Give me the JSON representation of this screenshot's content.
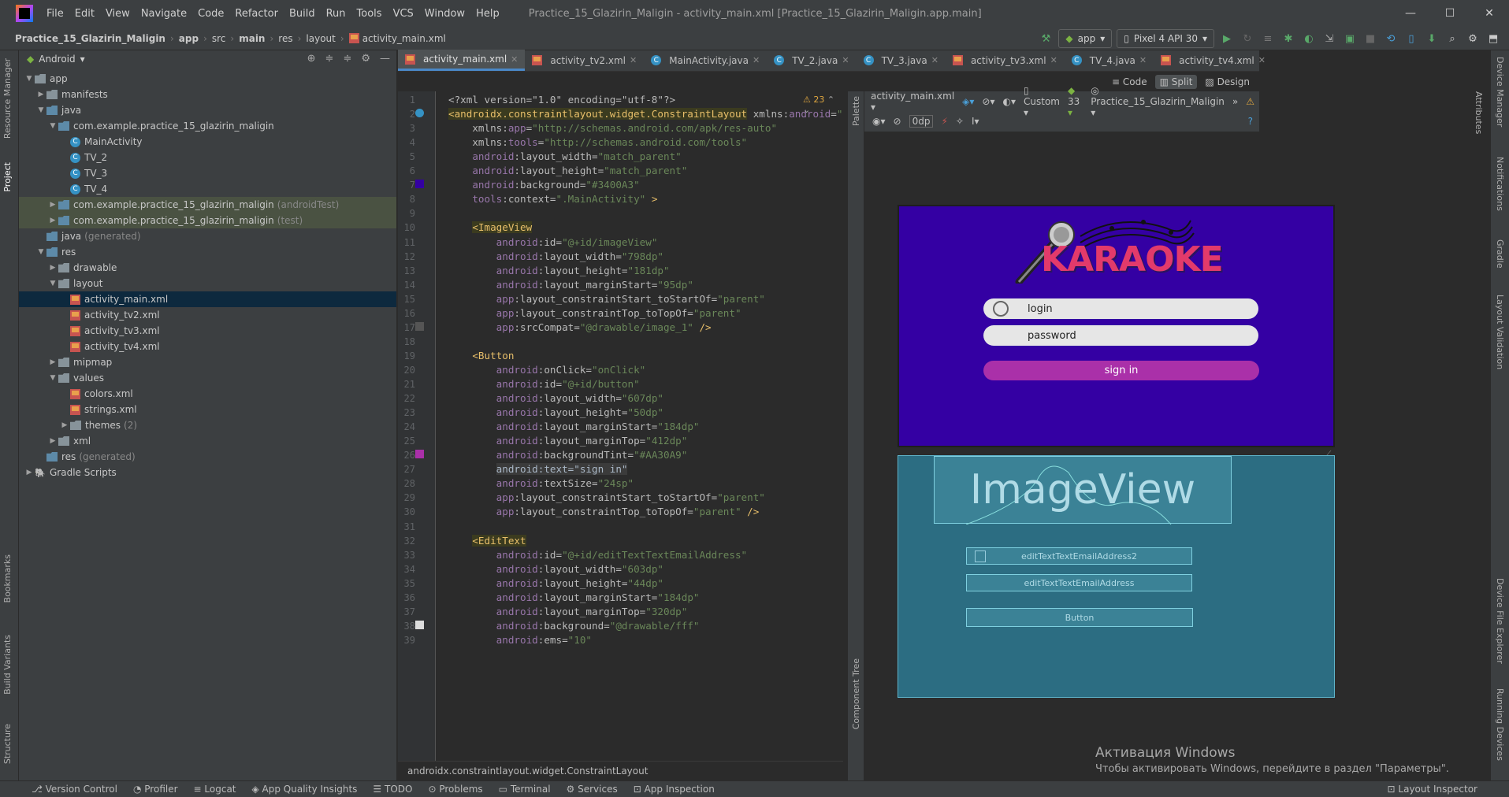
{
  "window": {
    "menu": [
      "File",
      "Edit",
      "View",
      "Navigate",
      "Code",
      "Refactor",
      "Build",
      "Run",
      "Tools",
      "VCS",
      "Window",
      "Help"
    ],
    "title": "Practice_15_Glazirin_Maligin - activity_main.xml [Practice_15_Glazirin_Maligin.app.main]",
    "controls": [
      "—",
      "☐",
      "✕"
    ]
  },
  "breadcrumb": [
    "Practice_15_Glazirin_Maligin",
    "app",
    "src",
    "main",
    "res",
    "layout",
    "activity_main.xml"
  ],
  "run": {
    "config": "app",
    "device": "Pixel 4 API 30"
  },
  "left_strip": [
    "Resource Manager",
    "Project",
    "Bookmarks",
    "Build Variants",
    "Structure"
  ],
  "right_strip": [
    "Device Manager",
    "Notifications",
    "Gradle",
    "Layout Validation",
    "Device File Explorer",
    "Running Devices"
  ],
  "right_strip_top": "Attributes",
  "project": {
    "view": "Android",
    "tree": [
      {
        "label": "app",
        "indent": 0,
        "arrow": "▼",
        "icon": "folder"
      },
      {
        "label": "manifests",
        "indent": 1,
        "arrow": "▶",
        "icon": "folder"
      },
      {
        "label": "java",
        "indent": 1,
        "arrow": "▼",
        "icon": "folder"
      },
      {
        "label": "com.example.practice_15_glazirin_maligin",
        "indent": 2,
        "arrow": "▼",
        "icon": "folder"
      },
      {
        "label": "MainActivity",
        "indent": 3,
        "arrow": "",
        "icon": "class"
      },
      {
        "label": "TV_2",
        "indent": 3,
        "arrow": "",
        "icon": "class"
      },
      {
        "label": "TV_3",
        "indent": 3,
        "arrow": "",
        "icon": "class"
      },
      {
        "label": "TV_4",
        "indent": 3,
        "arrow": "",
        "icon": "class"
      },
      {
        "label": "com.example.practice_15_glazirin_maligin",
        "suffix": "(androidTest)",
        "indent": 2,
        "arrow": "▶",
        "icon": "folder",
        "hl": true
      },
      {
        "label": "com.example.practice_15_glazirin_maligin",
        "suffix": "(test)",
        "indent": 2,
        "arrow": "▶",
        "icon": "folder",
        "hl": true
      },
      {
        "label": "java",
        "suffix": "(generated)",
        "indent": 1,
        "arrow": "",
        "icon": "folder"
      },
      {
        "label": "res",
        "indent": 1,
        "arrow": "▼",
        "icon": "folder"
      },
      {
        "label": "drawable",
        "indent": 2,
        "arrow": "▶",
        "icon": "folder"
      },
      {
        "label": "layout",
        "indent": 2,
        "arrow": "▼",
        "icon": "folder"
      },
      {
        "label": "activity_main.xml",
        "indent": 3,
        "arrow": "",
        "icon": "xml",
        "sel": true
      },
      {
        "label": "activity_tv2.xml",
        "indent": 3,
        "arrow": "",
        "icon": "xml"
      },
      {
        "label": "activity_tv3.xml",
        "indent": 3,
        "arrow": "",
        "icon": "xml"
      },
      {
        "label": "activity_tv4.xml",
        "indent": 3,
        "arrow": "",
        "icon": "xml"
      },
      {
        "label": "mipmap",
        "indent": 2,
        "arrow": "▶",
        "icon": "folder"
      },
      {
        "label": "values",
        "indent": 2,
        "arrow": "▼",
        "icon": "folder"
      },
      {
        "label": "colors.xml",
        "indent": 3,
        "arrow": "",
        "icon": "xml"
      },
      {
        "label": "strings.xml",
        "indent": 3,
        "arrow": "",
        "icon": "xml"
      },
      {
        "label": "themes",
        "suffix": "(2)",
        "indent": 3,
        "arrow": "▶",
        "icon": "folder"
      },
      {
        "label": "xml",
        "indent": 2,
        "arrow": "▶",
        "icon": "folder"
      },
      {
        "label": "res",
        "suffix": "(generated)",
        "indent": 1,
        "arrow": "",
        "icon": "folder"
      },
      {
        "label": "Gradle Scripts",
        "indent": 0,
        "arrow": "▶",
        "icon": "gradle"
      }
    ]
  },
  "tabs": [
    "activity_main.xml",
    "activity_tv2.xml",
    "MainActivity.java",
    "TV_2.java",
    "TV_3.java",
    "activity_tv3.xml",
    "TV_4.java",
    "activity_tv4.xml"
  ],
  "view_modes": [
    "Code",
    "Split",
    "Design"
  ],
  "warnings": "23",
  "code_lines": [
    [
      {
        "t": "<?xml version=\"1.0\" encoding=\"utf-8\"?>",
        "c": "attr"
      }
    ],
    [
      {
        "t": "<androidx.constraintlayout.widget.ConstraintLayout",
        "c": "tagbg"
      },
      {
        "t": " xmlns:",
        "c": "attr"
      },
      {
        "t": "android",
        "c": "ns"
      },
      {
        "t": "=",
        "c": "attr"
      },
      {
        "t": "\"http://schem",
        "c": "val"
      }
    ],
    [
      {
        "t": "    xmlns:",
        "c": "attr"
      },
      {
        "t": "app",
        "c": "ns"
      },
      {
        "t": "=",
        "c": "attr"
      },
      {
        "t": "\"http://schemas.android.com/apk/res-auto\"",
        "c": "val"
      }
    ],
    [
      {
        "t": "    xmlns:",
        "c": "attr"
      },
      {
        "t": "tools",
        "c": "ns"
      },
      {
        "t": "=",
        "c": "attr"
      },
      {
        "t": "\"http://schemas.android.com/tools\"",
        "c": "val"
      }
    ],
    [
      {
        "t": "    ",
        "c": "attr"
      },
      {
        "t": "android",
        "c": "ns"
      },
      {
        "t": ":layout_width=",
        "c": "attr"
      },
      {
        "t": "\"match_parent\"",
        "c": "val"
      }
    ],
    [
      {
        "t": "    ",
        "c": "attr"
      },
      {
        "t": "android",
        "c": "ns"
      },
      {
        "t": ":layout_height=",
        "c": "attr"
      },
      {
        "t": "\"match_parent\"",
        "c": "val"
      }
    ],
    [
      {
        "t": "    ",
        "c": "attr"
      },
      {
        "t": "android",
        "c": "ns"
      },
      {
        "t": ":background=",
        "c": "attr"
      },
      {
        "t": "\"#3400A3\"",
        "c": "val"
      }
    ],
    [
      {
        "t": "    ",
        "c": "attr"
      },
      {
        "t": "tools",
        "c": "ns"
      },
      {
        "t": ":context=",
        "c": "attr"
      },
      {
        "t": "\".MainActivity\"",
        "c": "val"
      },
      {
        "t": " >",
        "c": "tag"
      }
    ],
    [
      {
        "t": "",
        "c": "attr"
      }
    ],
    [
      {
        "t": "    ",
        "c": "attr"
      },
      {
        "t": "<ImageView",
        "c": "tagbg"
      }
    ],
    [
      {
        "t": "        ",
        "c": "attr"
      },
      {
        "t": "android",
        "c": "ns"
      },
      {
        "t": ":id=",
        "c": "attr"
      },
      {
        "t": "\"@+id/imageView\"",
        "c": "val"
      }
    ],
    [
      {
        "t": "        ",
        "c": "attr"
      },
      {
        "t": "android",
        "c": "ns"
      },
      {
        "t": ":layout_width=",
        "c": "attr"
      },
      {
        "t": "\"798dp\"",
        "c": "val"
      }
    ],
    [
      {
        "t": "        ",
        "c": "attr"
      },
      {
        "t": "android",
        "c": "ns"
      },
      {
        "t": ":layout_height=",
        "c": "attr"
      },
      {
        "t": "\"181dp\"",
        "c": "val"
      }
    ],
    [
      {
        "t": "        ",
        "c": "attr"
      },
      {
        "t": "android",
        "c": "ns"
      },
      {
        "t": ":layout_marginStart=",
        "c": "attr"
      },
      {
        "t": "\"95dp\"",
        "c": "val"
      }
    ],
    [
      {
        "t": "        ",
        "c": "attr"
      },
      {
        "t": "app",
        "c": "ns"
      },
      {
        "t": ":layout_constraintStart_toStartOf=",
        "c": "attr"
      },
      {
        "t": "\"parent\"",
        "c": "val"
      }
    ],
    [
      {
        "t": "        ",
        "c": "attr"
      },
      {
        "t": "app",
        "c": "ns"
      },
      {
        "t": ":layout_constraintTop_toTopOf=",
        "c": "attr"
      },
      {
        "t": "\"parent\"",
        "c": "val"
      }
    ],
    [
      {
        "t": "        ",
        "c": "attr"
      },
      {
        "t": "app",
        "c": "ns"
      },
      {
        "t": ":srcCompat=",
        "c": "attr"
      },
      {
        "t": "\"@drawable/image_1\"",
        "c": "val"
      },
      {
        "t": " />",
        "c": "tag"
      }
    ],
    [
      {
        "t": "",
        "c": "attr"
      }
    ],
    [
      {
        "t": "    ",
        "c": "attr"
      },
      {
        "t": "<Button",
        "c": "tag"
      }
    ],
    [
      {
        "t": "        ",
        "c": "attr"
      },
      {
        "t": "android",
        "c": "ns"
      },
      {
        "t": ":onClick=",
        "c": "attr"
      },
      {
        "t": "\"onClick\"",
        "c": "val"
      }
    ],
    [
      {
        "t": "        ",
        "c": "attr"
      },
      {
        "t": "android",
        "c": "ns"
      },
      {
        "t": ":id=",
        "c": "attr"
      },
      {
        "t": "\"@+id/button\"",
        "c": "val"
      }
    ],
    [
      {
        "t": "        ",
        "c": "attr"
      },
      {
        "t": "android",
        "c": "ns"
      },
      {
        "t": ":layout_width=",
        "c": "attr"
      },
      {
        "t": "\"607dp\"",
        "c": "val"
      }
    ],
    [
      {
        "t": "        ",
        "c": "attr"
      },
      {
        "t": "android",
        "c": "ns"
      },
      {
        "t": ":layout_height=",
        "c": "attr"
      },
      {
        "t": "\"50dp\"",
        "c": "val"
      }
    ],
    [
      {
        "t": "        ",
        "c": "attr"
      },
      {
        "t": "android",
        "c": "ns"
      },
      {
        "t": ":layout_marginStart=",
        "c": "attr"
      },
      {
        "t": "\"184dp\"",
        "c": "val"
      }
    ],
    [
      {
        "t": "        ",
        "c": "attr"
      },
      {
        "t": "android",
        "c": "ns"
      },
      {
        "t": ":layout_marginTop=",
        "c": "attr"
      },
      {
        "t": "\"412dp\"",
        "c": "val"
      }
    ],
    [
      {
        "t": "        ",
        "c": "attr"
      },
      {
        "t": "android",
        "c": "ns"
      },
      {
        "t": ":backgroundTint=",
        "c": "attr"
      },
      {
        "t": "\"#AA30A9\"",
        "c": "val"
      }
    ],
    [
      {
        "t": "        ",
        "c": "attr"
      },
      {
        "t": "android:text=\"sign in\"",
        "c": "hl2"
      }
    ],
    [
      {
        "t": "        ",
        "c": "attr"
      },
      {
        "t": "android",
        "c": "ns"
      },
      {
        "t": ":textSize=",
        "c": "attr"
      },
      {
        "t": "\"24sp\"",
        "c": "val"
      }
    ],
    [
      {
        "t": "        ",
        "c": "attr"
      },
      {
        "t": "app",
        "c": "ns"
      },
      {
        "t": ":layout_constraintStart_toStartOf=",
        "c": "attr"
      },
      {
        "t": "\"parent\"",
        "c": "val"
      }
    ],
    [
      {
        "t": "        ",
        "c": "attr"
      },
      {
        "t": "app",
        "c": "ns"
      },
      {
        "t": ":layout_constraintTop_toTopOf=",
        "c": "attr"
      },
      {
        "t": "\"parent\"",
        "c": "val"
      },
      {
        "t": " />",
        "c": "tag"
      }
    ],
    [
      {
        "t": "",
        "c": "attr"
      }
    ],
    [
      {
        "t": "    ",
        "c": "attr"
      },
      {
        "t": "<EditText",
        "c": "tagbg"
      }
    ],
    [
      {
        "t": "        ",
        "c": "attr"
      },
      {
        "t": "android",
        "c": "ns"
      },
      {
        "t": ":id=",
        "c": "attr"
      },
      {
        "t": "\"@+id/editTextTextEmailAddress\"",
        "c": "val"
      }
    ],
    [
      {
        "t": "        ",
        "c": "attr"
      },
      {
        "t": "android",
        "c": "ns"
      },
      {
        "t": ":layout_width=",
        "c": "attr"
      },
      {
        "t": "\"603dp\"",
        "c": "val"
      }
    ],
    [
      {
        "t": "        ",
        "c": "attr"
      },
      {
        "t": "android",
        "c": "ns"
      },
      {
        "t": ":layout_height=",
        "c": "attr"
      },
      {
        "t": "\"44dp\"",
        "c": "val"
      }
    ],
    [
      {
        "t": "        ",
        "c": "attr"
      },
      {
        "t": "android",
        "c": "ns"
      },
      {
        "t": ":layout_marginStart=",
        "c": "attr"
      },
      {
        "t": "\"184dp\"",
        "c": "val"
      }
    ],
    [
      {
        "t": "        ",
        "c": "attr"
      },
      {
        "t": "android",
        "c": "ns"
      },
      {
        "t": ":layout_marginTop=",
        "c": "attr"
      },
      {
        "t": "\"320dp\"",
        "c": "val"
      }
    ],
    [
      {
        "t": "        ",
        "c": "attr"
      },
      {
        "t": "android",
        "c": "ns"
      },
      {
        "t": ":background=",
        "c": "attr"
      },
      {
        "t": "\"@drawable/fff\"",
        "c": "val"
      }
    ],
    [
      {
        "t": "        ",
        "c": "attr"
      },
      {
        "t": "android",
        "c": "ns"
      },
      {
        "t": ":ems=",
        "c": "attr"
      },
      {
        "t": "\"10\"",
        "c": "val"
      }
    ]
  ],
  "code_footer": "androidx.constraintlayout.widget.ConstraintLayout",
  "design_toolbar": {
    "file": "activity_main.xml",
    "device": "Custom",
    "api": "33",
    "theme": "Practice_15_Glazirin_Maligin",
    "margin": "0dp"
  },
  "palette": "Palette",
  "component_tree": "Component Tree",
  "preview": {
    "logo": "KARAOKE",
    "login": "login",
    "password": "password",
    "signin": "sign in",
    "bg": "#3400A3",
    "accent": "#AA30A9"
  },
  "blueprint": {
    "image": "ImageView",
    "email2": "editTextTextEmailAddress2",
    "email": "editTextTextEmailAddress",
    "button": "Button"
  },
  "activation": {
    "title": "Активация Windows",
    "text": "Чтобы активировать Windows, перейдите в раздел \"Параметры\"."
  },
  "status": [
    "Version Control",
    "Profiler",
    "Logcat",
    "App Quality Insights",
    "TODO",
    "Problems",
    "Terminal",
    "Services",
    "App Inspection"
  ],
  "status_right": "Layout Inspector"
}
